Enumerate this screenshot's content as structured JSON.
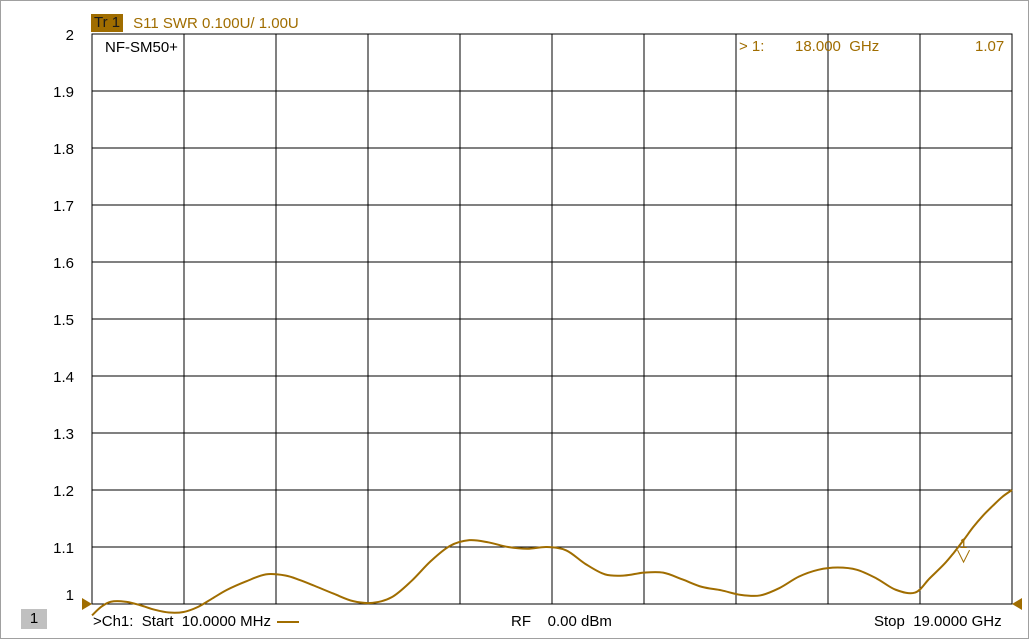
{
  "trace": {
    "badge": "Tr 1",
    "label": "S11 SWR 0.100U/  1.00U",
    "device": "NF-SM50+",
    "color": "#a06d00"
  },
  "marker": {
    "readout_prefix": "> 1:",
    "frequency": "18.000  GHz",
    "value": "1.07",
    "label": "1",
    "freq_ghz": 18.0,
    "swr": 1.07
  },
  "footer": {
    "channel_badge": "1",
    "start": ">Ch1:  Start  10.0000 MHz",
    "rf": "RF    0.00 dBm",
    "stop": "Stop  19.0000 GHz"
  },
  "chart_data": {
    "type": "line",
    "title": "",
    "xlabel": "",
    "ylabel": "",
    "xlim": [
      0.01,
      19.0
    ],
    "ylim": [
      1.0,
      2.0
    ],
    "x_divisions": 10,
    "y_ticks": [
      "2",
      "1.9",
      "1.8",
      "1.7",
      "1.6",
      "1.5",
      "1.4",
      "1.3",
      "1.2",
      "1.1",
      "1"
    ],
    "grid": true,
    "series": [
      {
        "x": [
          0.01,
          0.2,
          0.4,
          0.7,
          1.0,
          1.3,
          1.6,
          1.9,
          2.2,
          2.5,
          2.8,
          3.2,
          3.6,
          4.0,
          4.3,
          4.6,
          5.0,
          5.4,
          5.8,
          6.2,
          6.6,
          7.0,
          7.4,
          7.8,
          8.2,
          8.6,
          9.0,
          9.4,
          9.8,
          10.2,
          10.6,
          11.0,
          11.4,
          11.8,
          12.2,
          12.6,
          13.0,
          13.4,
          13.8,
          14.2,
          14.6,
          15.0,
          15.4,
          15.8,
          16.2,
          16.6,
          17.0,
          17.3,
          17.6,
          17.8,
          18.0,
          18.2,
          18.4,
          18.6,
          18.8,
          19.0
        ],
        "y": [
          0.98,
          0.995,
          1.004,
          1.004,
          0.998,
          0.99,
          0.985,
          0.986,
          0.995,
          1.01,
          1.025,
          1.04,
          1.052,
          1.05,
          1.042,
          1.032,
          1.018,
          1.005,
          1.002,
          1.012,
          1.04,
          1.075,
          1.102,
          1.112,
          1.108,
          1.1,
          1.097,
          1.1,
          1.094,
          1.07,
          1.052,
          1.05,
          1.055,
          1.055,
          1.043,
          1.03,
          1.024,
          1.016,
          1.015,
          1.028,
          1.048,
          1.06,
          1.064,
          1.06,
          1.045,
          1.025,
          1.02,
          1.045,
          1.07,
          1.09,
          1.112,
          1.135,
          1.155,
          1.172,
          1.188,
          1.2
        ]
      }
    ]
  }
}
